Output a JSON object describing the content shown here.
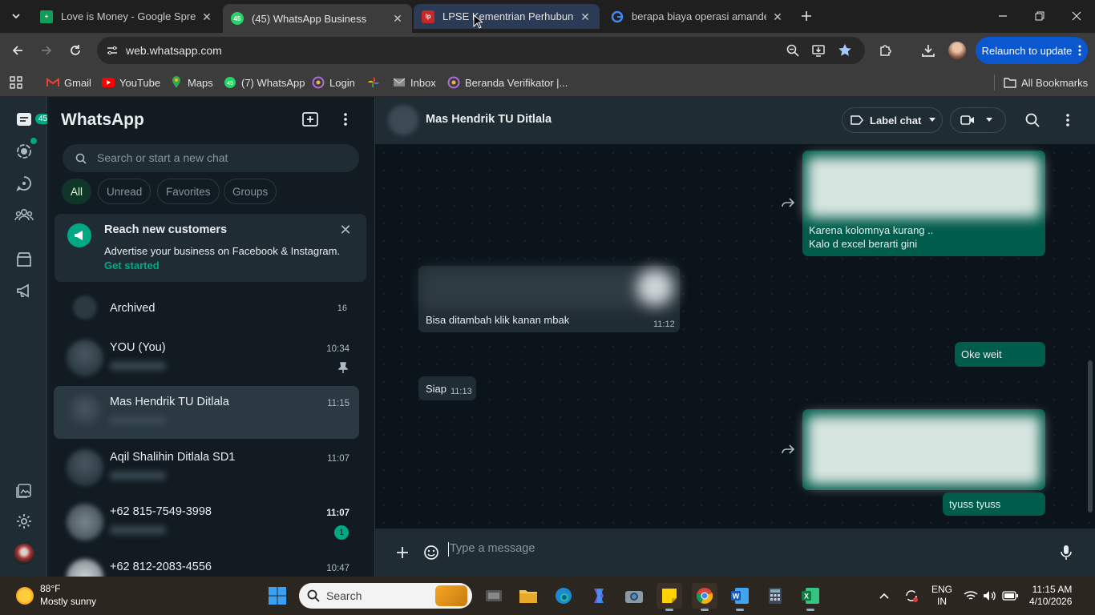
{
  "browser": {
    "tabs": [
      {
        "title": "Love is Money - Google Spread",
        "icon": "google-sheets-icon"
      },
      {
        "title": "(45) WhatsApp Business",
        "icon": "whatsapp-business-icon",
        "badge": "45"
      },
      {
        "title": "LPSE Kementrian Perhubungan",
        "icon": "lpse-icon"
      },
      {
        "title": "berapa biaya operasi amandel",
        "icon": "google-icon"
      }
    ],
    "url": "web.whatsapp.com",
    "relaunch_label": "Relaunch to update",
    "bookmarks": [
      {
        "label": "Gmail",
        "icon": "gmail-icon"
      },
      {
        "label": "YouTube",
        "icon": "youtube-icon"
      },
      {
        "label": "Maps",
        "icon": "maps-icon"
      },
      {
        "label": "(7) WhatsApp",
        "icon": "whatsapp-icon"
      },
      {
        "label": "Login",
        "icon": "login-icon"
      },
      {
        "label": "",
        "icon": "google-photos-icon"
      },
      {
        "label": "Inbox",
        "icon": "mail-icon"
      },
      {
        "label": "Beranda Verifikator |...",
        "icon": "verifikator-icon"
      }
    ],
    "all_bookmarks": "All Bookmarks"
  },
  "whatsapp": {
    "rail_badge": "45",
    "title": "WhatsApp",
    "search_placeholder": "Search or start a new chat",
    "filters": [
      "All",
      "Unread",
      "Favorites",
      "Groups"
    ],
    "promo": {
      "title": "Reach new customers",
      "text": "Advertise your business on Facebook & Instagram.",
      "link": "Get started"
    },
    "archived": {
      "label": "Archived",
      "count": "16"
    },
    "chats": [
      {
        "name": "YOU (You)",
        "time": "10:34",
        "pinned": true
      },
      {
        "name": "Mas Hendrik TU Ditlala",
        "time": "11:15",
        "selected": true
      },
      {
        "name": "Aqil Shalihin Ditlala SD1",
        "time": "11:07"
      },
      {
        "name": "+62 815-7549-3998",
        "time": "11:07",
        "unread": "1"
      },
      {
        "name": "+62 812-2083-4556",
        "time": "10:47"
      }
    ],
    "conversation": {
      "contact": "Mas Hendrik TU Ditlala",
      "label_chat": "Label chat",
      "messages": [
        {
          "dir": "out",
          "text1": "Karena kolomnya kurang ..",
          "text2": "Kalo d excel berarti gini",
          "forwardable": true
        },
        {
          "dir": "in",
          "text": "Bisa ditambah klik kanan mbak",
          "time": "11:12"
        },
        {
          "dir": "out",
          "text": "Oke weit"
        },
        {
          "dir": "in",
          "text": "Siap",
          "time": "11:13"
        },
        {
          "dir": "out",
          "text": "tyuss tyuss",
          "forwardable": true
        }
      ],
      "compose_placeholder": "Type a message"
    }
  },
  "taskbar": {
    "weather_temp": "88°F",
    "weather_text": "Mostly sunny",
    "search_placeholder": "Search",
    "lang1": "ENG",
    "lang2": "IN",
    "time": "11:15 AM",
    "date": "4/10/2026"
  },
  "colors": {
    "accent": "#00a884",
    "outgoing_bubble": "#005c4b",
    "incoming_bubble": "#202c33",
    "chat_bg": "#0b141a",
    "relaunch": "#0b57d0"
  }
}
